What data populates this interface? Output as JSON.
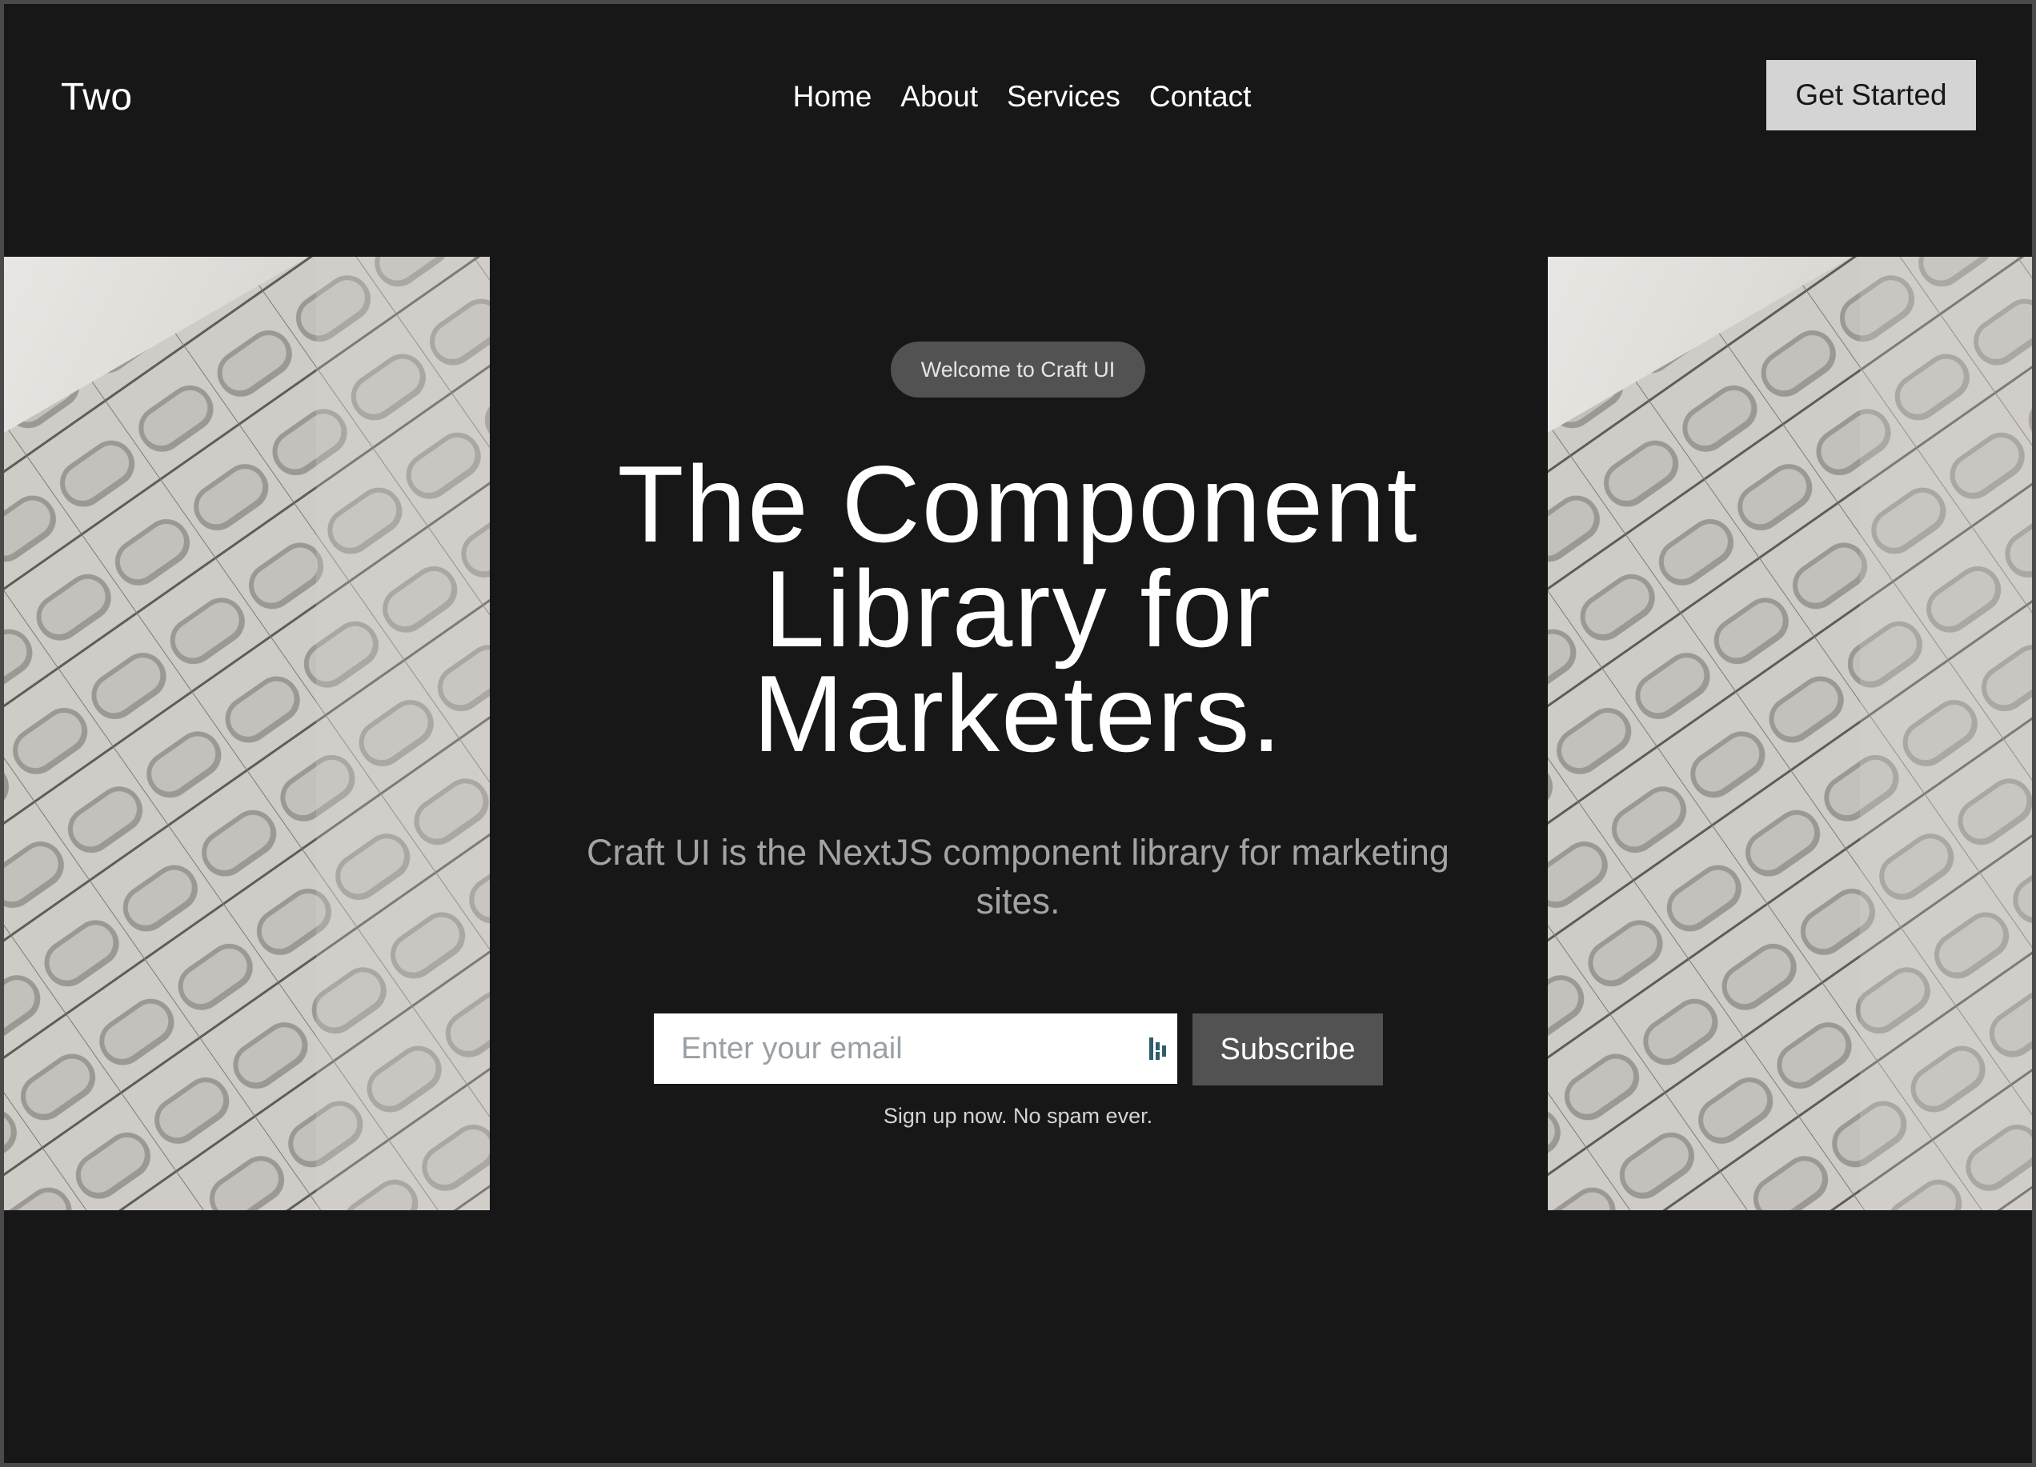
{
  "header": {
    "logo": "Two",
    "nav": [
      "Home",
      "About",
      "Services",
      "Contact"
    ],
    "cta_label": "Get Started"
  },
  "hero": {
    "badge": "Welcome to Craft UI",
    "headline_lines": [
      "The Component",
      "Library for",
      "Marketers."
    ],
    "subtitle": "Craft UI is the NextJS component library for marketing sites.",
    "email_placeholder": "Enter your email",
    "subscribe_label": "Subscribe",
    "note": "Sign up now. No spam ever."
  },
  "images": {
    "left": "architectural-facade-image",
    "right": "architectural-facade-image"
  },
  "colors": {
    "background": "#171717",
    "button_light": "#d4d4d4",
    "button_dark": "#525252",
    "badge": "#525252"
  }
}
